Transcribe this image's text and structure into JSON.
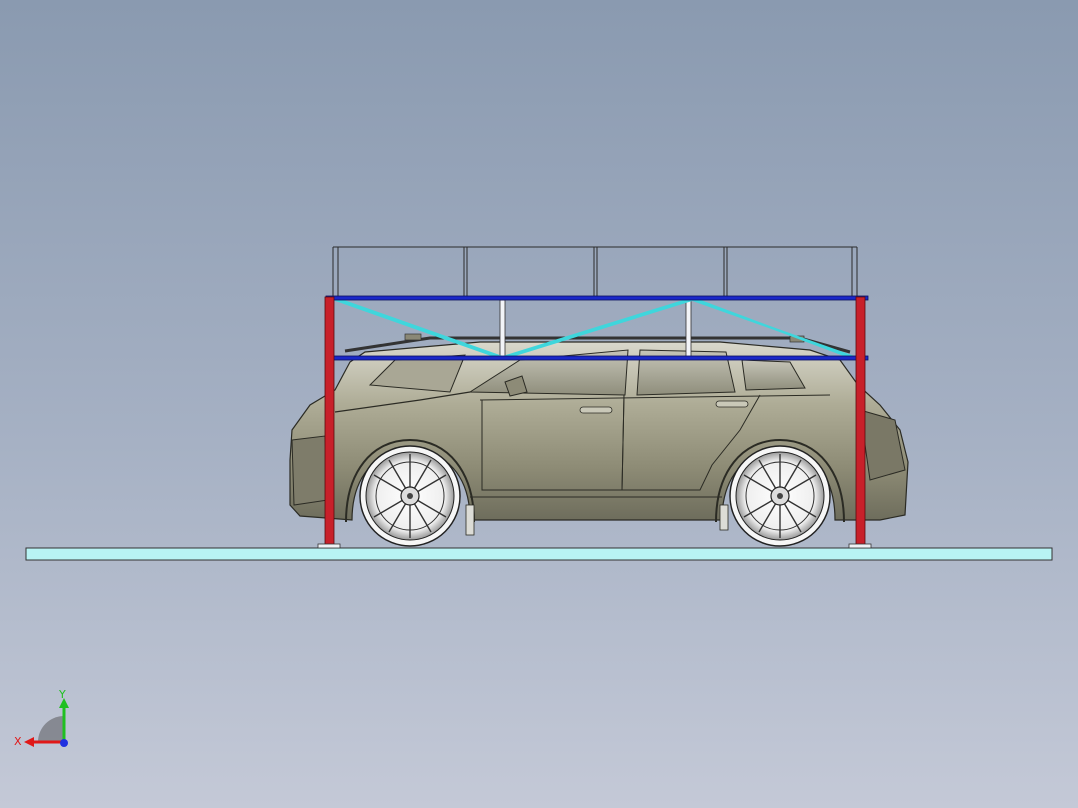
{
  "viewport": {
    "background_top": "#8a9ab0",
    "background_bottom": "#c4c9d7"
  },
  "model": {
    "components": [
      "ground-slab",
      "vehicle",
      "steel-frame",
      "railing"
    ],
    "colors": {
      "slab": "#b8f3f4",
      "column": "#c8202a",
      "beam": "#1a28c8",
      "brace": "#3fd6dc",
      "rail": "#e8ecf2",
      "body": "#9a9780"
    }
  },
  "triad": {
    "x_label": "X",
    "y_label": "Y",
    "x_color": "#e01818",
    "y_color": "#20c020",
    "z_color": "#2030e0"
  }
}
